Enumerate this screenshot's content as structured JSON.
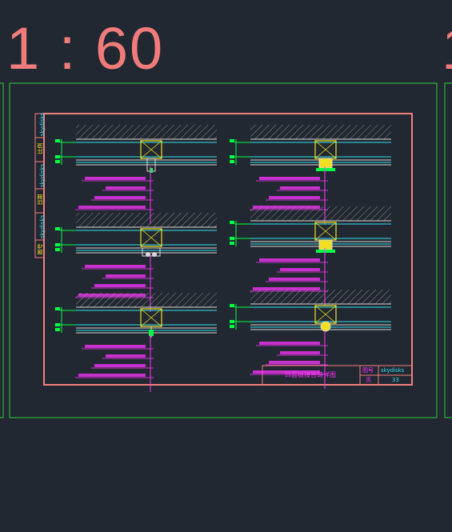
{
  "scale_label": "1 : 60",
  "scale_label_next": "1",
  "colors": {
    "background": "#222831",
    "viewport_border": "#2ecc40",
    "sheet_border": "#f08080",
    "leader_text": "#ff33ff",
    "dimension": "#00ff44",
    "hatch": "#8a8a8a",
    "cyan": "#33e0f0",
    "yellow": "#f0e020",
    "white": "#d8d8d8"
  },
  "title_block": {
    "drawing_name": "饰面板接合缝详图",
    "drawing_no_label": "图号",
    "drawing_no_value": "skydisks",
    "page_label": "页",
    "page_value": "33"
  },
  "side_strip_labels": [
    "skydisks",
    "比例",
    "skydisks",
    "日期",
    "skydisks",
    "图号"
  ]
}
